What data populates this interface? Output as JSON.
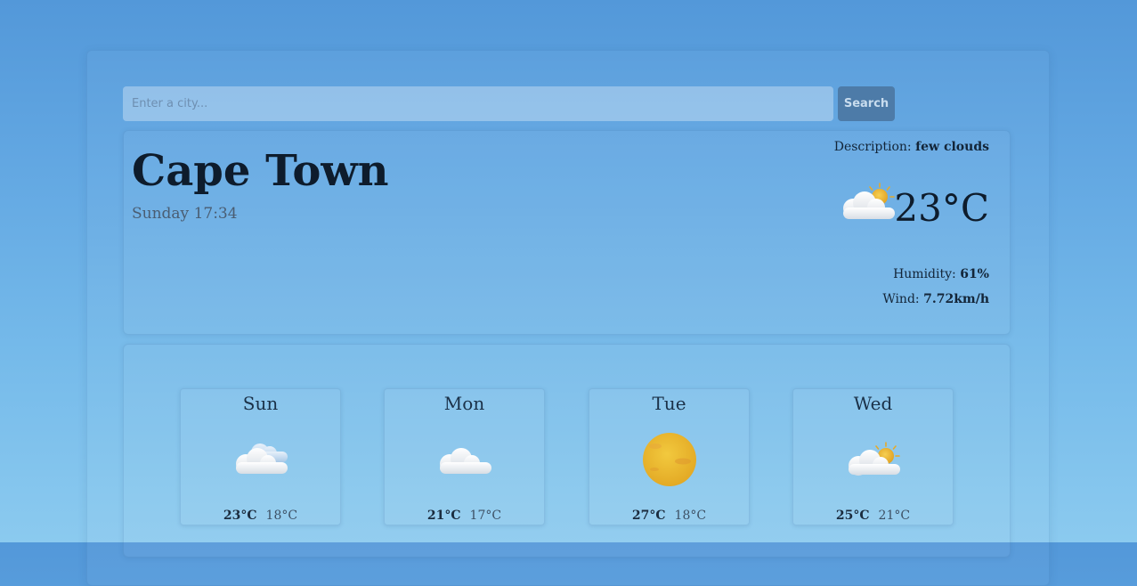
{
  "search": {
    "placeholder": "Enter a city...",
    "button_label": "Search"
  },
  "current": {
    "city": "Cape Town",
    "datetime": "Sunday 17:34",
    "description_label": "Description:",
    "description_value": "few clouds",
    "temperature": "23°C",
    "icon": "partly-cloudy-icon",
    "humidity_label": "Humidity:",
    "humidity_value": "61%",
    "wind_label": "Wind:",
    "wind_value": "7.72km/h"
  },
  "forecast": [
    {
      "day": "Sun",
      "icon": "cloudy-icon",
      "high": "23°C",
      "low": "18°C"
    },
    {
      "day": "Mon",
      "icon": "cloud-icon",
      "high": "21°C",
      "low": "17°C"
    },
    {
      "day": "Tue",
      "icon": "sun-icon",
      "high": "27°C",
      "low": "18°C"
    },
    {
      "day": "Wed",
      "icon": "partly-cloudy-icon",
      "high": "25°C",
      "low": "21°C"
    }
  ],
  "colors": {
    "accent": "#4d7ba8",
    "sun": "#eab62e",
    "cloud": "#eef1f5"
  }
}
